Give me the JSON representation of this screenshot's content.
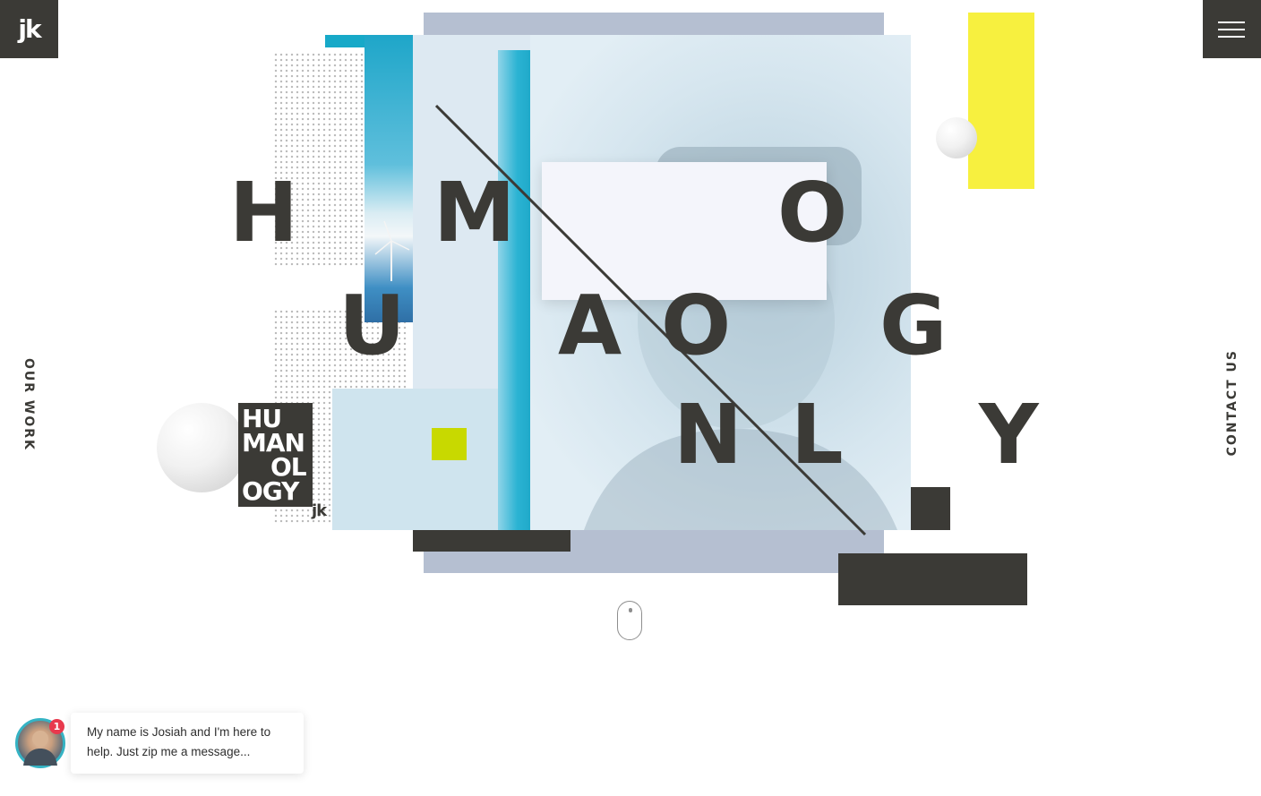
{
  "header": {
    "logo_text": "jk",
    "menu_icon": "hamburger-menu-icon"
  },
  "side_nav": {
    "left_label": "OUR WORK",
    "right_label": "CONTACT US"
  },
  "hero": {
    "letters": [
      "H",
      "M",
      "O",
      "U",
      "A",
      "O",
      "G",
      "N",
      "L",
      "Y"
    ],
    "logo_tile_lines": [
      "HU",
      "MAN",
      "OL",
      "OGY"
    ],
    "logo_tile_mark": "jk"
  },
  "scroll_hint": {
    "icon": "mouse-scroll-icon"
  },
  "chat": {
    "badge_count": "1",
    "message": "My name is Josiah and I'm here to help. Just zip me a message..."
  },
  "colors": {
    "dark": "#3b3a36",
    "yellow": "#f7f03f",
    "lime": "#c8d900",
    "cyan": "#1fb0cf",
    "light_blue": "#cfe4ee",
    "steel": "#b5bfd1",
    "chat_ring": "#35b3c4",
    "badge": "#e8394d"
  }
}
